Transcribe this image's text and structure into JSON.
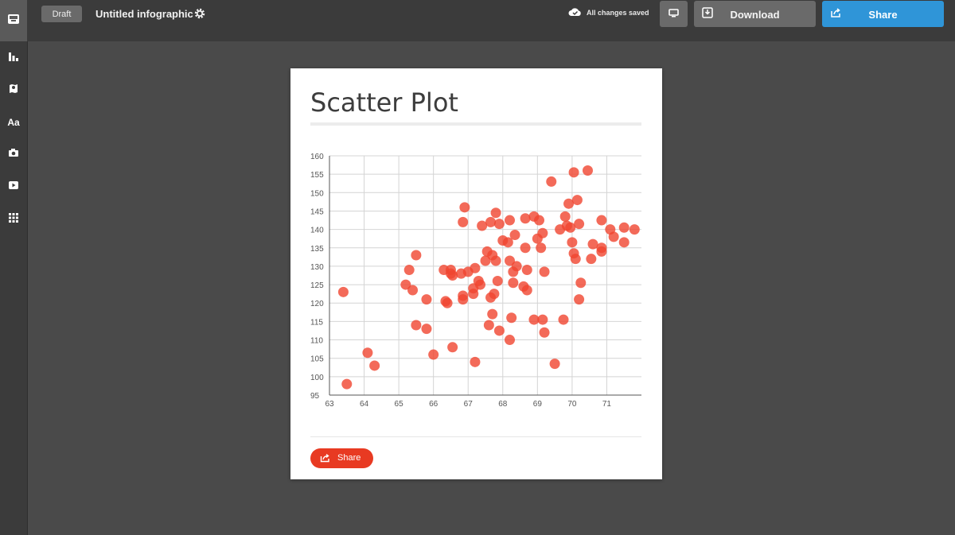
{
  "app": {
    "draft_label": "Draft",
    "doc_title": "Untitled infographic",
    "save_status": "All changes saved",
    "download_label": "Download",
    "share_label": "Share"
  },
  "sidebar": {
    "items": [
      {
        "name": "dashboard",
        "icon": "inbox-icon"
      },
      {
        "name": "charts",
        "icon": "bar-chart-icon"
      },
      {
        "name": "maps",
        "icon": "map-pin-icon"
      },
      {
        "name": "text",
        "icon": "text-icon",
        "label": "Aa"
      },
      {
        "name": "photos",
        "icon": "camera-icon"
      },
      {
        "name": "videos",
        "icon": "video-icon"
      },
      {
        "name": "more",
        "icon": "grid-icon"
      }
    ]
  },
  "card": {
    "share_label": "Share"
  },
  "colors": {
    "accent_blue": "#2f95d8",
    "share_red": "#e83a22",
    "point_red": "#f04530"
  },
  "chart_data": {
    "type": "scatter",
    "title": "Scatter Plot",
    "xlabel": "",
    "ylabel": "",
    "xlim": [
      63,
      72
    ],
    "ylim": [
      95,
      160
    ],
    "xticks": [
      63,
      64,
      65,
      66,
      67,
      68,
      69,
      70,
      71
    ],
    "yticks": [
      95,
      100,
      105,
      110,
      115,
      120,
      125,
      130,
      135,
      140,
      145,
      150,
      155,
      160
    ],
    "grid": true,
    "series": [
      {
        "color": "#f04530",
        "points": [
          [
            63.5,
            98
          ],
          [
            63.4,
            123
          ],
          [
            64.1,
            106.5
          ],
          [
            64.3,
            103
          ],
          [
            65.2,
            125
          ],
          [
            65.3,
            129
          ],
          [
            65.4,
            123.5
          ],
          [
            65.5,
            133
          ],
          [
            65.5,
            114
          ],
          [
            65.8,
            121
          ],
          [
            65.8,
            113
          ],
          [
            66.0,
            106
          ],
          [
            66.3,
            129
          ],
          [
            66.35,
            120.5
          ],
          [
            66.4,
            120
          ],
          [
            66.5,
            129
          ],
          [
            66.5,
            128
          ],
          [
            66.55,
            127.5
          ],
          [
            66.55,
            108
          ],
          [
            66.8,
            128
          ],
          [
            66.85,
            122
          ],
          [
            66.85,
            121
          ],
          [
            66.85,
            142
          ],
          [
            66.9,
            146
          ],
          [
            67.0,
            128.5
          ],
          [
            67.15,
            124
          ],
          [
            67.15,
            122.5
          ],
          [
            67.2,
            129.5
          ],
          [
            67.2,
            104
          ],
          [
            67.3,
            126
          ],
          [
            67.35,
            125
          ],
          [
            67.4,
            141
          ],
          [
            67.5,
            131.5
          ],
          [
            67.55,
            134
          ],
          [
            67.6,
            114
          ],
          [
            67.65,
            142
          ],
          [
            67.65,
            121.5
          ],
          [
            67.7,
            117
          ],
          [
            67.7,
            133
          ],
          [
            67.75,
            122.5
          ],
          [
            67.8,
            144.5
          ],
          [
            67.8,
            131.5
          ],
          [
            67.85,
            126
          ],
          [
            67.9,
            141.5
          ],
          [
            67.9,
            112.5
          ],
          [
            68.0,
            137
          ],
          [
            68.15,
            136.5
          ],
          [
            68.2,
            142.5
          ],
          [
            68.2,
            131.5
          ],
          [
            68.2,
            110
          ],
          [
            68.25,
            116
          ],
          [
            68.3,
            128.5
          ],
          [
            68.3,
            125.5
          ],
          [
            68.35,
            138.5
          ],
          [
            68.4,
            130
          ],
          [
            68.6,
            124.5
          ],
          [
            68.65,
            143
          ],
          [
            68.65,
            135
          ],
          [
            68.7,
            129
          ],
          [
            68.7,
            123.5
          ],
          [
            68.9,
            143.5
          ],
          [
            68.9,
            115.5
          ],
          [
            69.0,
            137.5
          ],
          [
            69.05,
            142.5
          ],
          [
            69.1,
            135
          ],
          [
            69.15,
            139
          ],
          [
            69.15,
            115.5
          ],
          [
            69.2,
            128.5
          ],
          [
            69.2,
            112
          ],
          [
            69.4,
            153
          ],
          [
            69.5,
            103.5
          ],
          [
            69.65,
            140
          ],
          [
            69.75,
            115.5
          ],
          [
            69.8,
            143.5
          ],
          [
            69.85,
            141
          ],
          [
            69.9,
            147
          ],
          [
            69.95,
            140.5
          ],
          [
            70.0,
            136.5
          ],
          [
            70.05,
            155.5
          ],
          [
            70.05,
            133.5
          ],
          [
            70.1,
            132
          ],
          [
            70.15,
            148
          ],
          [
            70.2,
            141.5
          ],
          [
            70.2,
            121
          ],
          [
            70.25,
            125.5
          ],
          [
            70.45,
            156
          ],
          [
            70.55,
            132
          ],
          [
            70.6,
            136
          ],
          [
            70.85,
            142.5
          ],
          [
            70.85,
            135
          ],
          [
            70.85,
            134
          ],
          [
            71.1,
            140
          ],
          [
            71.2,
            138
          ],
          [
            71.5,
            140.5
          ],
          [
            71.5,
            136.5
          ],
          [
            71.8,
            140
          ]
        ]
      }
    ]
  }
}
